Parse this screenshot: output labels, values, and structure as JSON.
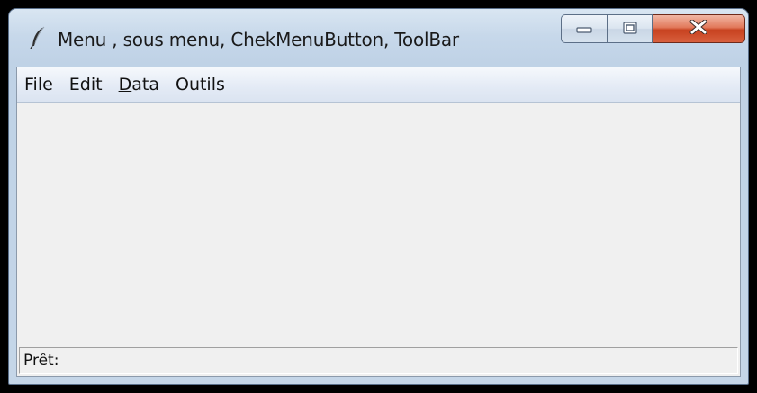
{
  "window": {
    "title": "Menu , sous menu, ChekMenuButton, ToolBar",
    "app_icon": "feather-icon",
    "caption_buttons": {
      "minimize_icon": "minimize-icon",
      "maximize_icon": "maximize-icon",
      "close_icon": "close-icon"
    }
  },
  "menubar": {
    "items": [
      {
        "label": "File",
        "underline_first": false
      },
      {
        "label": "Edit",
        "underline_first": false
      },
      {
        "label": "Data",
        "underline_first": true
      },
      {
        "label": "Outils",
        "underline_first": false
      }
    ]
  },
  "statusbar": {
    "text": "Prêt:"
  },
  "colors": {
    "title_bar": "#c7d8ea",
    "menubar": "#e3eaf5",
    "client_background": "#f0f0f0",
    "close_button": "#c7411f",
    "outer_background": "#000000"
  }
}
